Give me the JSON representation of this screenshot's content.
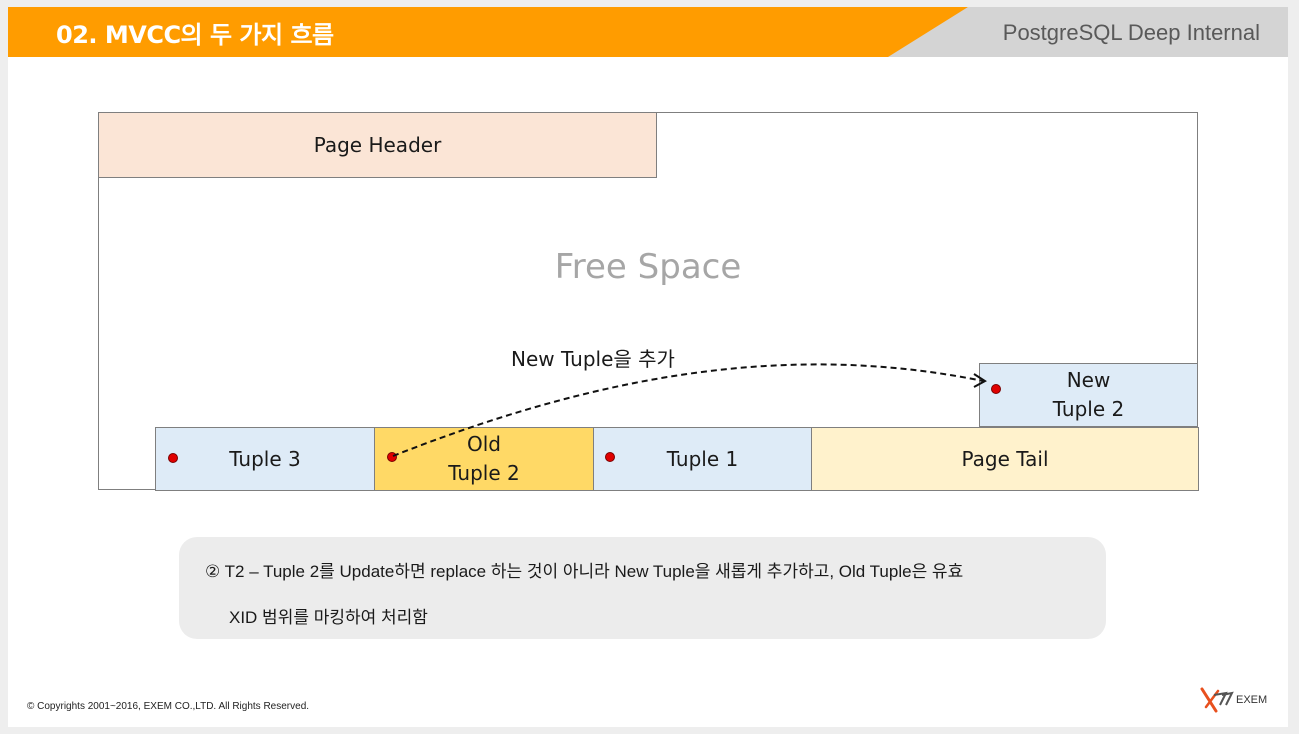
{
  "header": {
    "title": "02. MVCC의 두 가지 흐름",
    "brand": "PostgreSQL Deep Internal"
  },
  "diagram": {
    "page_header": "Page Header",
    "free_space": "Free Space",
    "arrow_label": "New Tuple을 추가",
    "cells": {
      "tuple3": "Tuple 3",
      "old_tuple2": "Old\nTuple 2",
      "tuple1": "Tuple 1",
      "page_tail": "Page Tail",
      "new_tuple2": "New\nTuple 2"
    }
  },
  "note": {
    "line1": "② T2 – Tuple 2를 Update하면 replace 하는 것이 아니라 New Tuple을 새롭게 추가하고, Old Tuple은 유효",
    "line2": "XID 범위를 마킹하여 처리함"
  },
  "footer": {
    "copyright": "© Copyrights 2001~2016, EXEM CO.,LTD. All Rights Reserved.",
    "logo_text": "EXEM"
  },
  "colors": {
    "title_bar": "#ff9c00",
    "brand_bar": "#d4d4d4",
    "page_header_fill": "#fbe5d6",
    "tuple_fill": "#deebf7",
    "old_tuple_fill": "#ffd966",
    "page_tail_fill": "#fff2cc",
    "dot": "#e00000"
  }
}
